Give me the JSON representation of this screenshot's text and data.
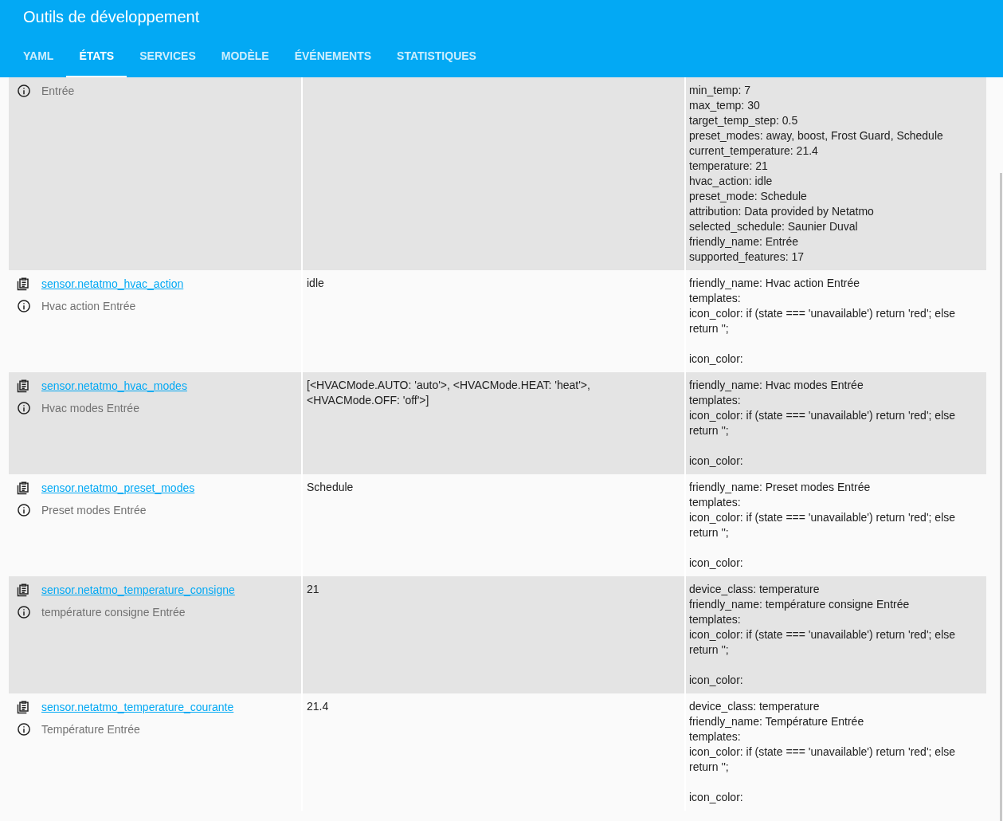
{
  "header": {
    "title": "Outils de développement"
  },
  "tabs": [
    {
      "label": "YAML",
      "selected": false
    },
    {
      "label": "ÉTATS",
      "selected": true
    },
    {
      "label": "SERVICES",
      "selected": false
    },
    {
      "label": "MODÈLE",
      "selected": false
    },
    {
      "label": "ÉVÉNEMENTS",
      "selected": false
    },
    {
      "label": "STATISTIQUES",
      "selected": false
    }
  ],
  "rows": [
    {
      "friendly_name": "Entrée",
      "attributes": [
        "min_temp: 7",
        "max_temp: 30",
        "target_temp_step: 0.5",
        "preset_modes: away, boost, Frost Guard, Schedule",
        "current_temperature: 21.4",
        "temperature: 21",
        "hvac_action: idle",
        "preset_mode: Schedule",
        "attribution: Data provided by Netatmo",
        "selected_schedule: Saunier Duval",
        "friendly_name: Entrée",
        "supported_features: 17"
      ]
    },
    {
      "entity_id": "sensor.netatmo_hvac_action",
      "friendly_name": "Hvac action Entrée",
      "state": "idle",
      "attributes": [
        "friendly_name: Hvac action Entrée",
        "templates:",
        "icon_color: if (state === 'unavailable') return 'red'; else return '';"
      ],
      "trailing": "icon_color:"
    },
    {
      "entity_id": "sensor.netatmo_hvac_modes",
      "friendly_name": "Hvac modes Entrée",
      "state": "[<HVACMode.AUTO: 'auto'>, <HVACMode.HEAT: 'heat'>, <HVACMode.OFF: 'off'>]",
      "attributes": [
        "friendly_name: Hvac modes Entrée",
        "templates:",
        "icon_color: if (state === 'unavailable') return 'red'; else return '';"
      ],
      "trailing": "icon_color:"
    },
    {
      "entity_id": "sensor.netatmo_preset_modes",
      "friendly_name": "Preset modes Entrée",
      "state": "Schedule",
      "attributes": [
        "friendly_name: Preset modes Entrée",
        "templates:",
        "icon_color: if (state === 'unavailable') return 'red'; else return '';"
      ],
      "trailing": "icon_color:"
    },
    {
      "entity_id": "sensor.netatmo_temperature_consigne",
      "friendly_name": "température consigne Entrée",
      "state": "21",
      "attributes": [
        "device_class: temperature",
        "friendly_name: température consigne Entrée",
        "templates:",
        "icon_color: if (state === 'unavailable') return 'red'; else return '';"
      ],
      "trailing": "icon_color:"
    },
    {
      "entity_id": "sensor.netatmo_temperature_courante",
      "friendly_name": "Température Entrée",
      "state": "21.4",
      "attributes": [
        "device_class: temperature",
        "friendly_name: Température Entrée",
        "templates:",
        "icon_color: if (state === 'unavailable') return 'red'; else return '';"
      ],
      "trailing": "icon_color:"
    }
  ]
}
